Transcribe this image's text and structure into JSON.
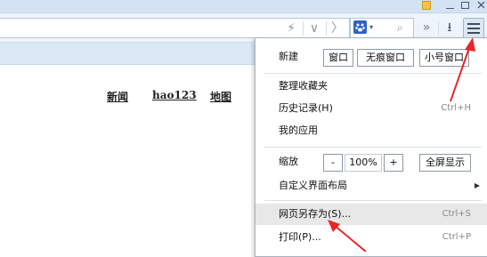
{
  "titlebar": {
    "icons": [
      "skin-icon",
      "minimize-icon",
      "maximize-icon",
      "close-icon"
    ]
  },
  "toolbar": {
    "lightning": "⚡",
    "dropdown": "∨",
    "forward": "〉",
    "search_provider_icon": "paw-icon",
    "search_caret": "▾",
    "search_glass": "⌕",
    "more": "»",
    "download": "⭳"
  },
  "page": {
    "links": [
      "新闻",
      "hao123",
      "地图"
    ]
  },
  "menu": {
    "new_label": "新建",
    "window_buttons": [
      "窗口",
      "无痕窗口",
      "小号窗口"
    ],
    "items": [
      {
        "label": "整理收藏夹",
        "shortcut": ""
      },
      {
        "label": "历史记录(H)",
        "shortcut": "Ctrl+H"
      },
      {
        "label": "我的应用",
        "shortcut": ""
      }
    ],
    "zoom_label": "缩放",
    "zoom_minus": "-",
    "zoom_value": "100%",
    "zoom_plus": "+",
    "fullscreen": "全屏显示",
    "customize": "自定义界面布局",
    "customize_arrow": "▶",
    "save": {
      "label": "网页另存为(S)...",
      "shortcut": "Ctrl+S"
    },
    "print": {
      "label": "打印(P)...",
      "shortcut": "Ctrl+P"
    }
  },
  "colors": {
    "annotation_arrow": "#e8262a",
    "highlight": "#e8e8e8"
  }
}
